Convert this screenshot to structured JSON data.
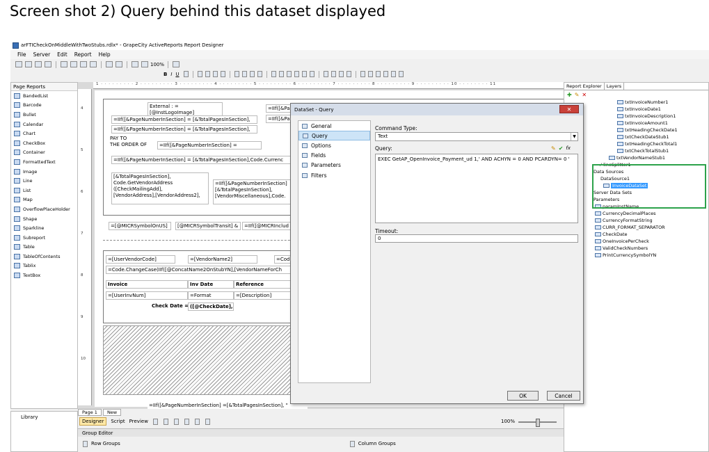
{
  "caption": "Screen shot 2) Query behind this dataset displayed",
  "window": {
    "title": "arFTICheckOnMiddleWithTwoStubs.rdlx* - GrapeCity ActiveReports Report Designer"
  },
  "menu": [
    "File",
    "Server",
    "Edit",
    "Report",
    "Help"
  ],
  "toolbar": {
    "zoom": "100%",
    "bold": "B",
    "italic": "I",
    "underline": "U"
  },
  "left_panel": {
    "title": "Page Reports",
    "items": [
      "BandedList",
      "Barcode",
      "Bullet",
      "Calendar",
      "Chart",
      "CheckBox",
      "Container",
      "FormattedText",
      "Image",
      "Line",
      "List",
      "Map",
      "OverflowPlaceHolder",
      "Shape",
      "Sparkline",
      "Subreport",
      "Table",
      "TableOfContents",
      "Tablix",
      "TextBox"
    ],
    "library": "Library"
  },
  "ruler": {
    "h": "1 · · · · · · · · · 2 · · · · · · · · · 3 · · · · · · · · · 4 · · · · · · · · · 5 · · · · · · · · · 6 · · · · · · · · · 7 · · · · · · · · · 8 · · · · · · · · · 9 · · · · · · · · · 10 · · · · · · · · 11",
    "v": [
      "4",
      "5",
      "6",
      "7",
      "8",
      "9",
      "10"
    ]
  },
  "report": {
    "f1": "External : =",
    "f1b": "[@InstLogoImage]",
    "f2": "=IIf([&Pa",
    "f2b": "=IIf([&Pa",
    "f3": "=IIf([&PageNumberInSection] = [&TotalPagesInSection],",
    "f4": "=IIf([&PageNumberInSection] = [&TotalPagesInSection],",
    "payto": "PAY TO",
    "order": "THE ORDER OF",
    "f5": "=IIf([&PageNumberInSection] =",
    "f6": "=IIf([&PageNumberInSection] = [&TotalPagesInSection],Code.Currenc",
    "f7a": "[&TotalPagesInSection],",
    "f7b": "Code.GetVendorAddress",
    "f7c": "([CheckMailingAdd],",
    "f7d": "[VendorAddress],[VendorAddress2],",
    "f8a": "=IIf([&PageNumberInSection]",
    "f8b": "[&TotalPagesInSection],",
    "f8c": "[VendorMiscellaneous],Code.",
    "f9": "=[@MICRSymbolOnUS]",
    "f10": "[@MICRSymbolTransit] &",
    "f11": "=IIf([@MICRInclud",
    "f12": "=[UserVendorCode]",
    "f13": "=[VendorName2]",
    "f14": "=Cod",
    "f15": "=Code.ChangeCase(IIf([@ConcatName2OnStubYN],[VendorNameForCh",
    "col1": "Invoice",
    "col2": "Inv Date",
    "col3": "Reference",
    "r1": "=[UserInvNum]",
    "r2": "=Format",
    "r3": "=[Description]",
    "checkdate": "Check Date =",
    "checkdateval": "([@CheckDate],",
    "footer": "=IIf([&PageNumberInSection] =[&TotalPagesInSection], \""
  },
  "bottom": {
    "tabs": [
      "Page 1",
      "New"
    ],
    "designer": "Designer",
    "script": "Script",
    "preview": "Preview",
    "zoom": "100%",
    "group_editor": "Group Editor",
    "row_groups": "Row Groups",
    "column_groups": "Column Groups"
  },
  "right_panel": {
    "tabs": [
      "Report Explorer",
      "Layers"
    ],
    "tree": [
      "txtInvoiceNumber1",
      "txtInvoiceDate1",
      "txtInvoiceDescription1",
      "txtInvoiceAmount1",
      "txtHeadingCheckDate1",
      "txtCheckDateStub1",
      "txtHeadingCheckTotal1",
      "txtCheckTotalStub1",
      "txtVendorNameStub1",
      "lineSplitter1",
      "Data Sources",
      "DataSource1",
      "InvoiceDataSet",
      "Server Data Sets",
      "Parameters",
      "paramInstName",
      "CurrencyDecimalPlaces",
      "CurrencyFormatString",
      "CURR_FORMAT_SEPARATOR",
      "CheckDate",
      "OneInvoicePerCheck",
      "ValidCheckNumbers",
      "PrintCurrencySymbolYN"
    ]
  },
  "dialog": {
    "title": "DataSet - Query",
    "nav": [
      "General",
      "Query",
      "Options",
      "Fields",
      "Parameters",
      "Filters"
    ],
    "command_type_label": "Command Type:",
    "command_type_value": "Text",
    "query_label": "Query:",
    "query_value": "EXEC GetAP_OpenInvoice_Payment_ud 1,' AND ACHYN = 0 AND PCARDYN= 0 '",
    "timeout_label": "Timeout:",
    "timeout_value": "0",
    "ok": "OK",
    "cancel": "Cancel",
    "close": "✕"
  },
  "colors": {
    "highlight": "#2ca24a",
    "selection": "#3399ff",
    "close": "#c9413a"
  }
}
